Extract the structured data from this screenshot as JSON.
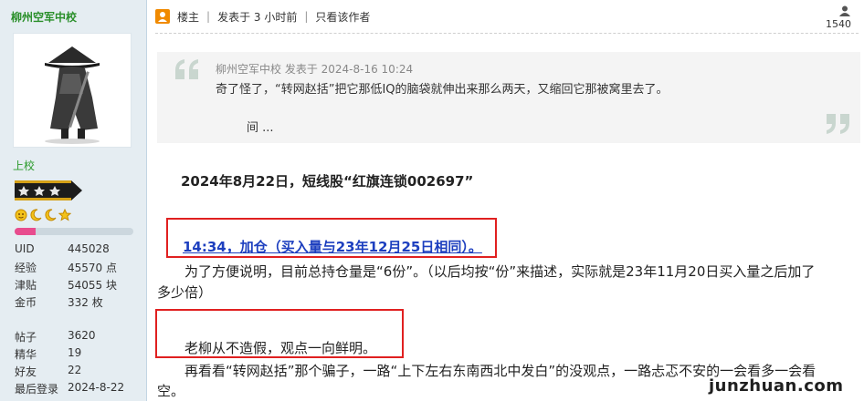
{
  "sidebar": {
    "username": "柳州空军中校",
    "rank": "上校",
    "progress_percent": 18,
    "stats_group1": [
      {
        "label": "UID",
        "value": "445028"
      },
      {
        "label": "经验",
        "value": "45570 点"
      },
      {
        "label": "津贴",
        "value": "54055 块"
      },
      {
        "label": "金币",
        "value": "332 枚"
      }
    ],
    "stats_group2": [
      {
        "label": "帖子",
        "value": "3620"
      },
      {
        "label": "精华",
        "value": "19"
      },
      {
        "label": "好友",
        "value": "22"
      },
      {
        "label": "最后登录",
        "value": "2024-8-22"
      }
    ],
    "colors": {
      "username": "#2a8f2a",
      "rank": "#2a9a2a",
      "progress": "#e84c8e"
    }
  },
  "post_header": {
    "op_label": "楼主",
    "time": "发表于 3 小时前",
    "only_author": "只看该作者",
    "view_count": "1540"
  },
  "quote": {
    "meta": "柳州空军中校 发表于 2024-8-16 10:24",
    "text": "奇了怪了，“转网赵括”把它那低IQ的脑袋就伸出来那么两天，又缩回它那被窝里去了。",
    "more": "间 ..."
  },
  "body": {
    "headline": "2024年8月22日，短线股“红旗连锁002697”",
    "update": "14:34，加仓（买入量与23年12月25日相同）。",
    "para1_a": "为了方便说明，目前总持仓量是“6份”。（以后均按“份”来描述，实际就是23年11月20日买入量之后加了",
    "para1_b": "多少倍）",
    "para2": "老柳从不造假，观点一向鲜明。",
    "para3_a": "再看看“转网赵括”那个骗子，一路“上下左右东南西北中发白”的没观点，一路忐忑不安的一会看多一会看",
    "para3_b": "空。"
  },
  "watermark": "junzhuan.com",
  "colors": {
    "highlight_box": "#e02020",
    "update_text": "#1d3fbf"
  }
}
